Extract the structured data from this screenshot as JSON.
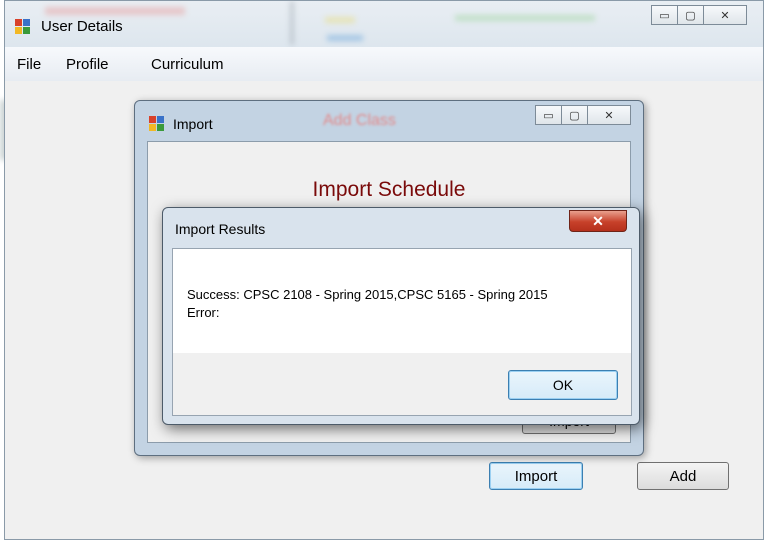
{
  "main_window": {
    "title": "User Details",
    "controls": {
      "minimize": "▭",
      "maximize": "▢",
      "close": "✕"
    },
    "menu": [
      "File",
      "Profile",
      "Curriculum"
    ],
    "import_button": "Import",
    "add_button": "Add"
  },
  "import_window": {
    "title": "Import",
    "background_caption": "Add Class",
    "controls": {
      "minimize": "▭",
      "maximize": "▢",
      "close": "✕"
    },
    "heading": "Import Schedule",
    "hidden_button": "Import"
  },
  "results_dialog": {
    "title": "Import Results",
    "close": "✕",
    "success_line": "Success: CPSC 2108 - Spring 2015,CPSC 5165 - Spring 2015",
    "error_line": "Error:",
    "ok_button": "OK"
  },
  "colors": {
    "heading": "#7a0a0a",
    "titlebar": "#dde6ee",
    "close_red": "#c7412a",
    "focus_border": "#3c7fb1"
  }
}
